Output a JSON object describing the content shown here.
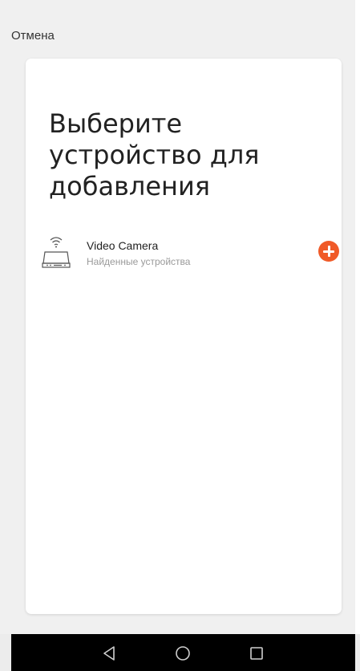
{
  "header": {
    "cancel_label": "Отмена"
  },
  "card": {
    "title": "Выберите устройство для добавления",
    "devices": [
      {
        "name": "Video Camera",
        "subtitle": "Найденные устройства",
        "icon": "video-camera-wifi-icon",
        "action_icon": "add-circle-icon"
      }
    ]
  },
  "colors": {
    "accent": "#f05a28",
    "background": "#f0f0f0",
    "card": "#ffffff",
    "navbar": "#000000"
  },
  "navbar": {
    "icons": [
      "back-triangle-icon",
      "home-circle-icon",
      "recents-square-icon"
    ]
  }
}
